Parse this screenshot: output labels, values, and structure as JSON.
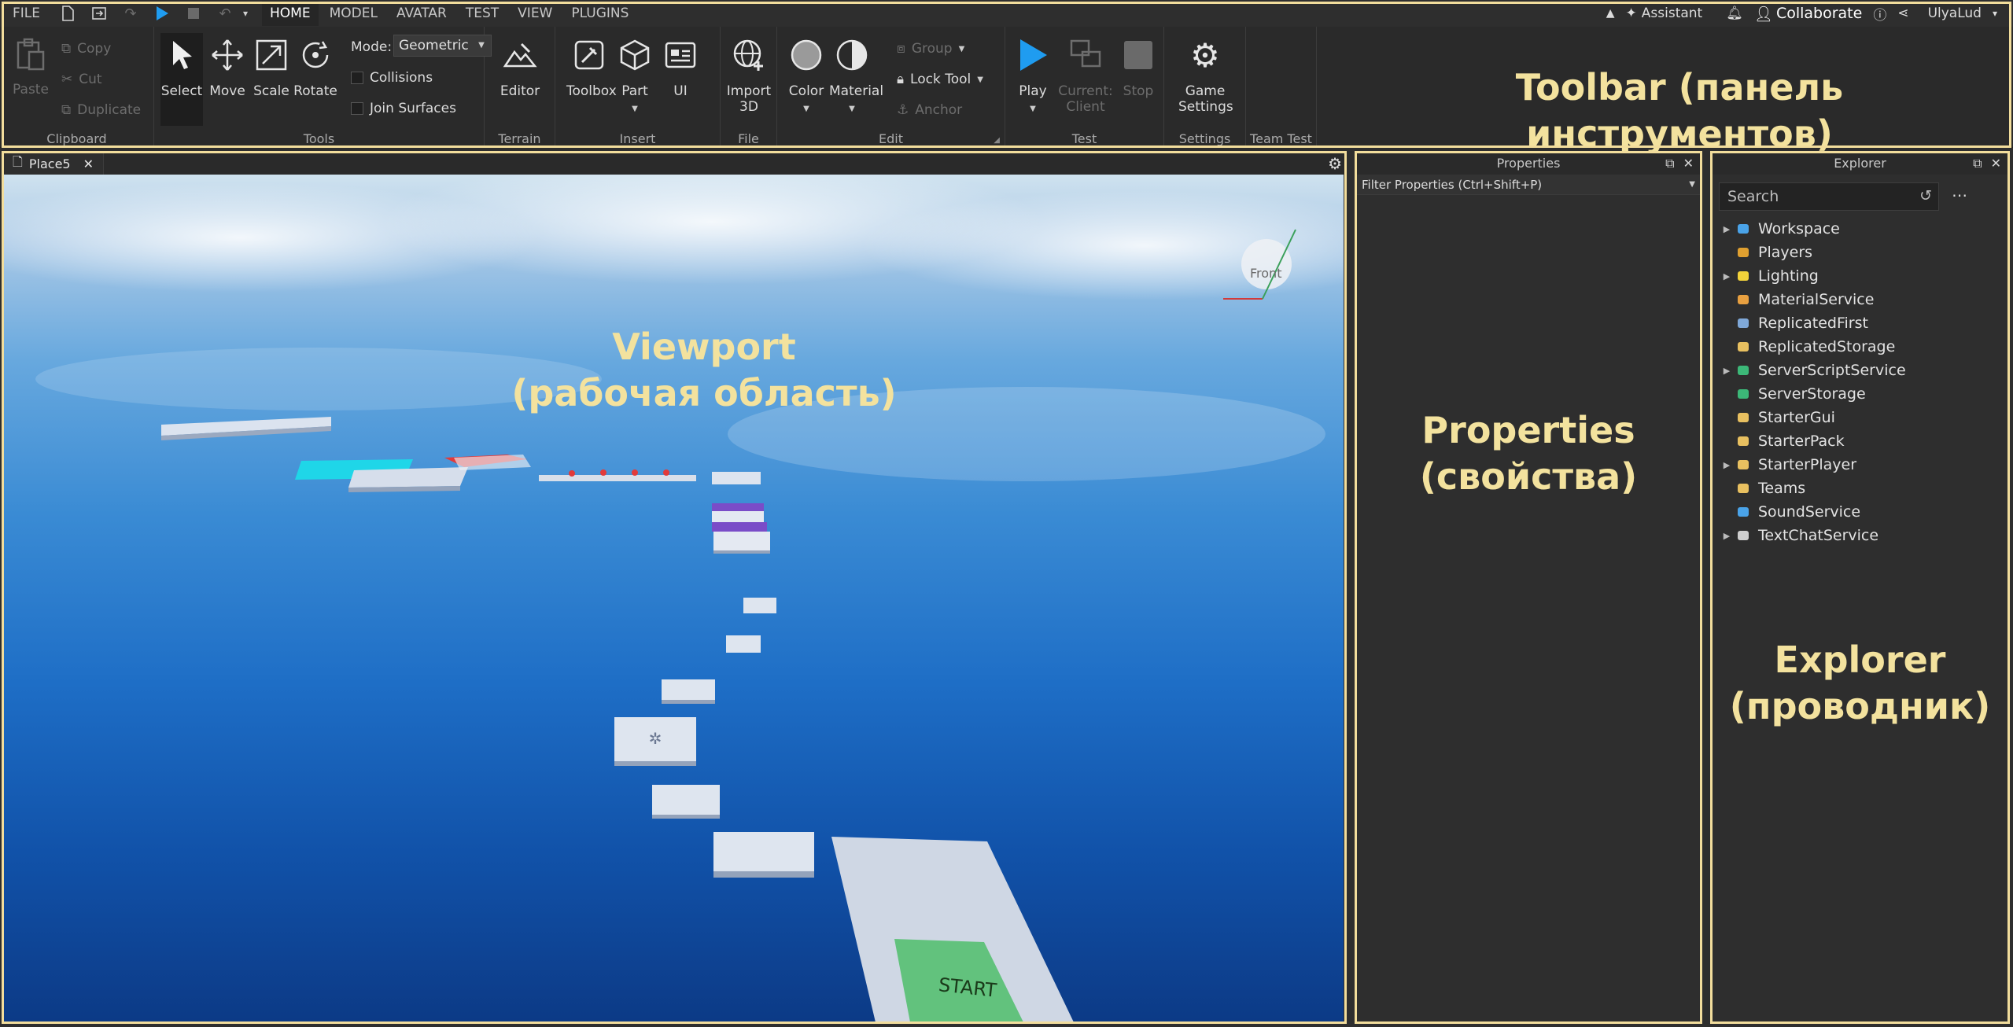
{
  "menubar": {
    "file": "FILE",
    "tabs": [
      "HOME",
      "MODEL",
      "AVATAR",
      "TEST",
      "VIEW",
      "PLUGINS"
    ],
    "active_tab": "HOME",
    "assistant": "Assistant",
    "collaborate": "Collaborate",
    "user": "UlyaLud"
  },
  "ribbon": {
    "clipboard": {
      "label": "Clipboard",
      "paste": "Paste",
      "copy": "Copy",
      "cut": "Cut",
      "duplicate": "Duplicate"
    },
    "tools": {
      "label": "Tools",
      "select": "Select",
      "move": "Move",
      "scale": "Scale",
      "rotate": "Rotate",
      "mode_label": "Mode:",
      "mode_value": "Geometric",
      "collisions": "Collisions",
      "join_surfaces": "Join Surfaces"
    },
    "terrain": {
      "label": "Terrain",
      "editor": "Editor"
    },
    "insert": {
      "label": "Insert",
      "toolbox": "Toolbox",
      "part": "Part",
      "ui": "UI"
    },
    "file": {
      "label": "File",
      "import": "Import",
      "import2": "3D"
    },
    "edit": {
      "label": "Edit",
      "color": "Color",
      "material": "Material",
      "group": "Group",
      "lock_tool": "Lock Tool",
      "anchor": "Anchor"
    },
    "test": {
      "label": "Test",
      "play": "Play",
      "current": "Current:",
      "client": "Client",
      "stop": "Stop"
    },
    "settings": {
      "label": "Settings",
      "game": "Game",
      "settings": "Settings"
    },
    "team_test": {
      "label": "Team Test"
    }
  },
  "annotations": {
    "toolbar": "Toolbar (панель инструментов)",
    "viewport_1": "Viewport",
    "viewport_2": "(рабочая область)",
    "properties_1": "Properties",
    "properties_2": "(свойства)",
    "explorer_1": "Explorer",
    "explorer_2": "(проводник)"
  },
  "viewport": {
    "tab": "Place5",
    "view_cube": "Front",
    "start_label": "START"
  },
  "properties": {
    "title": "Properties",
    "filter": "Filter Properties (Ctrl+Shift+P)"
  },
  "explorer": {
    "title": "Explorer",
    "search_placeholder": "Search",
    "items": [
      {
        "label": "Workspace",
        "expandable": true,
        "icon": "globe-icon",
        "color": "#4aa3e8"
      },
      {
        "label": "Players",
        "expandable": false,
        "icon": "players-icon",
        "color": "#e0a030"
      },
      {
        "label": "Lighting",
        "expandable": true,
        "icon": "bulb-icon",
        "color": "#f2d23a"
      },
      {
        "label": "MaterialService",
        "expandable": false,
        "icon": "material-icon",
        "color": "#e8a040"
      },
      {
        "label": "ReplicatedFirst",
        "expandable": false,
        "icon": "replicated-first-icon",
        "color": "#7fa8d8"
      },
      {
        "label": "ReplicatedStorage",
        "expandable": false,
        "icon": "replicated-storage-icon",
        "color": "#e8c060"
      },
      {
        "label": "ServerScriptService",
        "expandable": true,
        "icon": "server-script-icon",
        "color": "#3cb878"
      },
      {
        "label": "ServerStorage",
        "expandable": false,
        "icon": "server-storage-icon",
        "color": "#3cb878"
      },
      {
        "label": "StarterGui",
        "expandable": false,
        "icon": "starter-gui-icon",
        "color": "#e8c060"
      },
      {
        "label": "StarterPack",
        "expandable": false,
        "icon": "starter-pack-icon",
        "color": "#e8c060"
      },
      {
        "label": "StarterPlayer",
        "expandable": true,
        "icon": "starter-player-icon",
        "color": "#e8c060"
      },
      {
        "label": "Teams",
        "expandable": false,
        "icon": "teams-icon",
        "color": "#e8c060"
      },
      {
        "label": "SoundService",
        "expandable": false,
        "icon": "sound-icon",
        "color": "#4aa3e8"
      },
      {
        "label": "TextChatService",
        "expandable": true,
        "icon": "text-chat-icon",
        "color": "#cfcfcf"
      }
    ]
  },
  "colors": {
    "annotation": "#f3e29e",
    "frame": "#f2dd9c",
    "play_blue": "#1f9cf0",
    "start_green": "#62c27d",
    "cyan_part": "#1fd6e8",
    "purple_part": "#7a4cc8",
    "red_part": "#e23a3a"
  }
}
